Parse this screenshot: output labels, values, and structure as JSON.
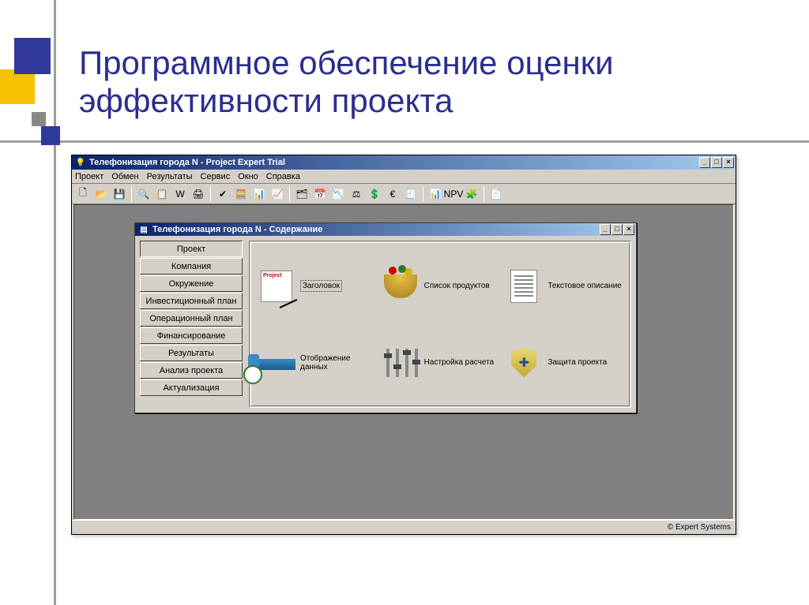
{
  "slide": {
    "title": "Программное обеспечение оценки эффективности проекта"
  },
  "app": {
    "title": "Телефонизация города N - Project Expert Trial",
    "menu": [
      "Проект",
      "Обмен",
      "Результаты",
      "Сервис",
      "Окно",
      "Справка"
    ],
    "status": "© Expert Systems",
    "win_min": "_",
    "win_max": "□",
    "win_close": "×"
  },
  "child": {
    "title": "Телефонизация города N - Содержание",
    "win_min": "_",
    "win_max": "□",
    "win_close": "×",
    "tabs": [
      "Проект",
      "Компания",
      "Окружение",
      "Инвестиционный план",
      "Операционный план",
      "Финансирование",
      "Результаты",
      "Анализ проекта",
      "Актуализация"
    ],
    "tiles": {
      "title_label": "Заголовок",
      "products_label": "Список продуктов",
      "text_label": "Текстовое описание",
      "display_label": "Отображение данных",
      "calc_label": "Настройка расчета",
      "protect_label": "Защита проекта"
    }
  },
  "toolbar_icons": [
    "🗋",
    "📂",
    "💾",
    "🔍",
    "📋",
    "W",
    "🖨",
    "✔",
    "🧮",
    "📊",
    "📈",
    "🗂",
    "📅",
    "📉",
    "⚖",
    "💲",
    "€",
    "🧾",
    "📊",
    "📐",
    "NPV",
    "🧩",
    "📄"
  ]
}
